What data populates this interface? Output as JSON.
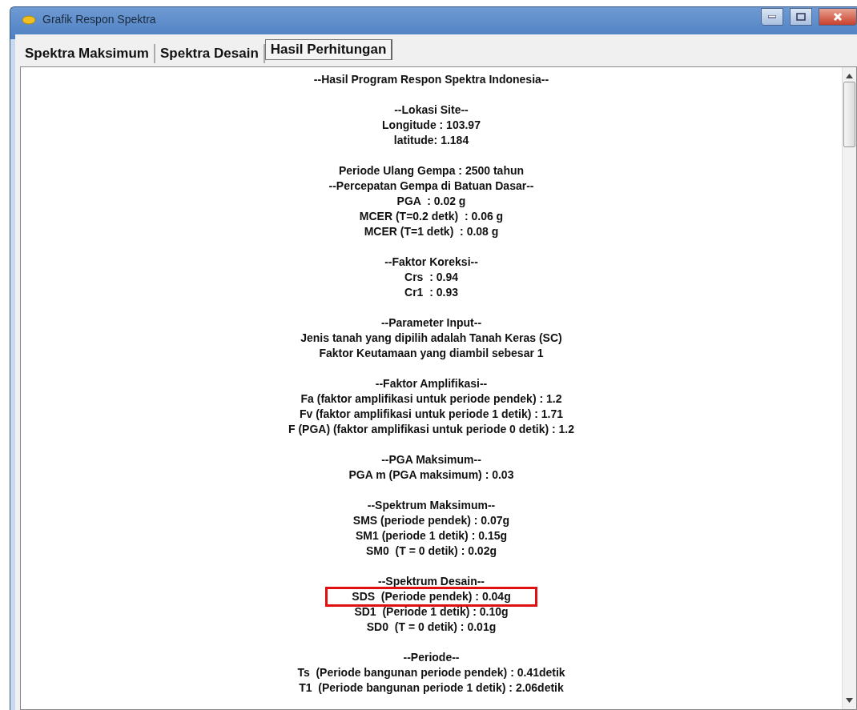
{
  "window": {
    "title": "Grafik Respon Spektra"
  },
  "tabs": [
    {
      "label": "Spektra Maksimum",
      "selected": false
    },
    {
      "label": "Spektra Desain",
      "selected": false
    },
    {
      "label": "Hasil Perhitungan",
      "selected": true
    }
  ],
  "report": {
    "title": "--Hasil Program Respon Spektra Indonesia--",
    "sections": [
      {
        "heading": "--Lokasi Site--",
        "lines": [
          {
            "text": "Longitude : 103.97",
            "highlighted": false
          },
          {
            "text": "latitude: 1.184",
            "highlighted": false
          }
        ]
      },
      {
        "heading": "Periode Ulang Gempa : 2500 tahun",
        "lines": [
          {
            "text": "--Percepatan Gempa di Batuan Dasar--",
            "highlighted": false
          },
          {
            "text": "PGA  : 0.02 g",
            "highlighted": false
          },
          {
            "text": "MCER (T=0.2 detk)  : 0.06 g",
            "highlighted": false
          },
          {
            "text": "MCER (T=1 detk)  : 0.08 g",
            "highlighted": false
          }
        ]
      },
      {
        "heading": "--Faktor Koreksi--",
        "lines": [
          {
            "text": "Crs  : 0.94",
            "highlighted": false
          },
          {
            "text": "Cr1  : 0.93",
            "highlighted": false
          }
        ]
      },
      {
        "heading": "--Parameter Input--",
        "lines": [
          {
            "text": "Jenis tanah yang dipilih adalah Tanah Keras (SC)",
            "highlighted": false
          },
          {
            "text": "Faktor Keutamaan yang diambil sebesar 1",
            "highlighted": false
          }
        ]
      },
      {
        "heading": "--Faktor Amplifikasi--",
        "lines": [
          {
            "text": "Fa (faktor amplifikasi untuk periode pendek) : 1.2",
            "highlighted": false
          },
          {
            "text": "Fv (faktor amplifikasi untuk periode 1 detik) : 1.71",
            "highlighted": false
          },
          {
            "text": "F (PGA) (faktor amplifikasi untuk periode 0 detik) : 1.2",
            "highlighted": false
          }
        ]
      },
      {
        "heading": "--PGA Maksimum--",
        "lines": [
          {
            "text": "PGA m (PGA maksimum) : 0.03",
            "highlighted": false
          }
        ]
      },
      {
        "heading": "--Spektrum Maksimum--",
        "lines": [
          {
            "text": "SMS (periode pendek) : 0.07g",
            "highlighted": false
          },
          {
            "text": "SM1 (periode 1 detik) : 0.15g",
            "highlighted": false
          },
          {
            "text": "SM0  (T = 0 detik) : 0.02g",
            "highlighted": false
          }
        ]
      },
      {
        "heading": "--Spektrum Desain--",
        "lines": [
          {
            "text": "SDS  (Periode pendek) : 0.04g",
            "highlighted": true
          },
          {
            "text": "SD1  (Periode 1 detik) : 0.10g",
            "highlighted": false
          },
          {
            "text": "SD0  (T = 0 detik) : 0.01g",
            "highlighted": false
          }
        ]
      },
      {
        "heading": "--Periode--",
        "lines": [
          {
            "text": "Ts  (Periode bangunan periode pendek) : 0.41detik",
            "highlighted": false
          },
          {
            "text": "T1  (Periode bangunan periode 1 detik) : 2.06detik",
            "highlighted": false
          }
        ]
      }
    ]
  }
}
